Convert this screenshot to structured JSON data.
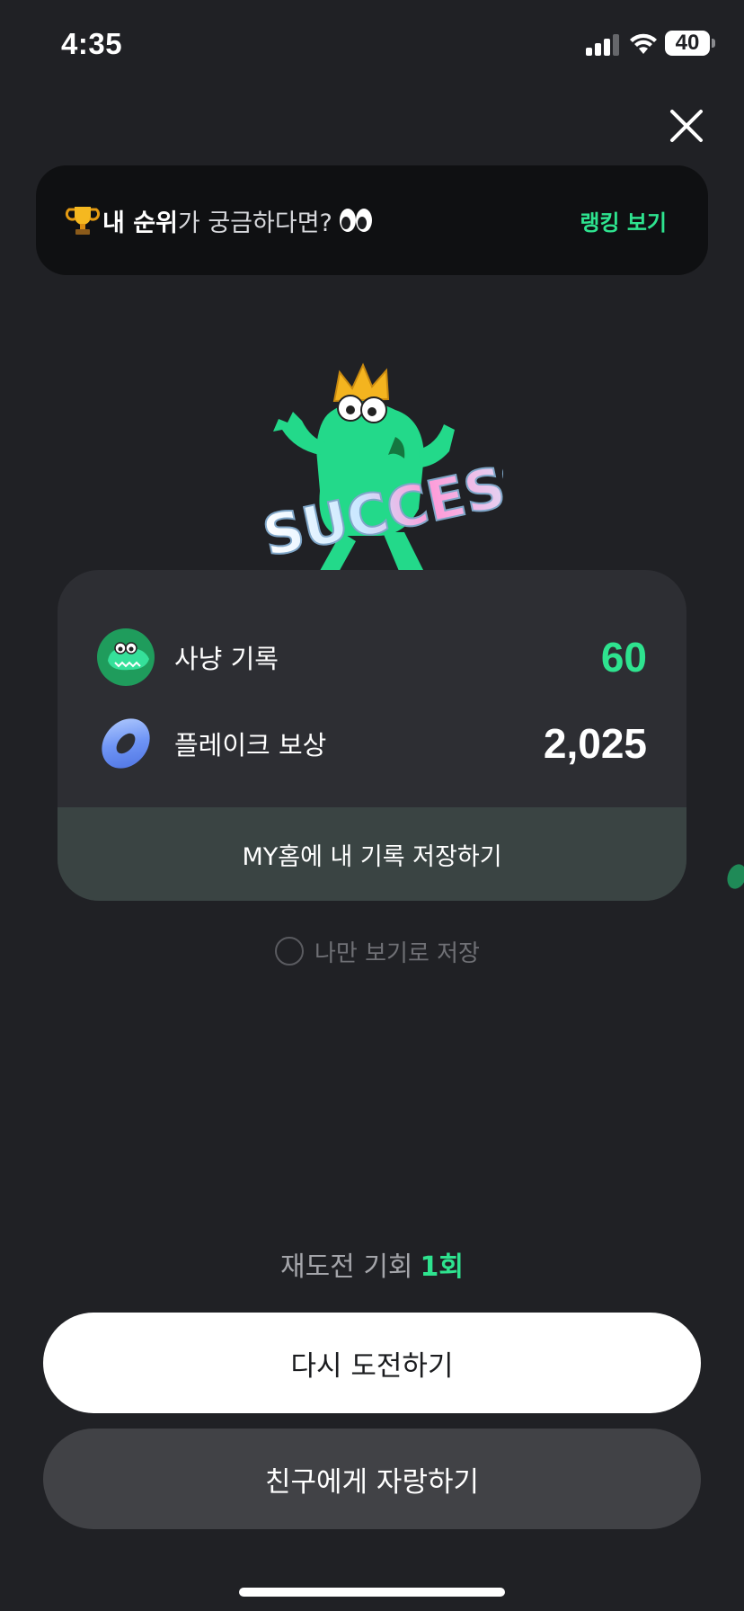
{
  "status_bar": {
    "time": "4:35",
    "battery": "40",
    "icons": [
      "signal-icon",
      "wifi-icon",
      "battery-icon"
    ]
  },
  "close": {
    "icon": "close-icon"
  },
  "banner": {
    "trophy_icon": "trophy-icon",
    "emphasis": "내 순위",
    "text": "가 궁금하다면?",
    "eyes_icon": "eyes-icon",
    "link": "랭킹 보기"
  },
  "mascot": {
    "icon": "success-mascot-icon",
    "text": "SUCCESS"
  },
  "result": {
    "hunt": {
      "label": "사냥 기록",
      "value": "60",
      "icon": "crocodile-avatar-icon"
    },
    "reward": {
      "label": "플레이크 보상",
      "value": "2,025",
      "icon": "donut-icon"
    },
    "save_label": "MY홈에 내 기록 저장하기"
  },
  "private_save": {
    "label": "나만 보기로 저장",
    "checked": false
  },
  "retry": {
    "label": "재도전 기회",
    "count": "1회"
  },
  "buttons": {
    "retry": "다시 도전하기",
    "share": "친구에게 자랑하기"
  },
  "colors": {
    "background": "#202125",
    "accent": "#2ee38f",
    "card": "#2d2e33",
    "save_bar": "#3a4443"
  }
}
